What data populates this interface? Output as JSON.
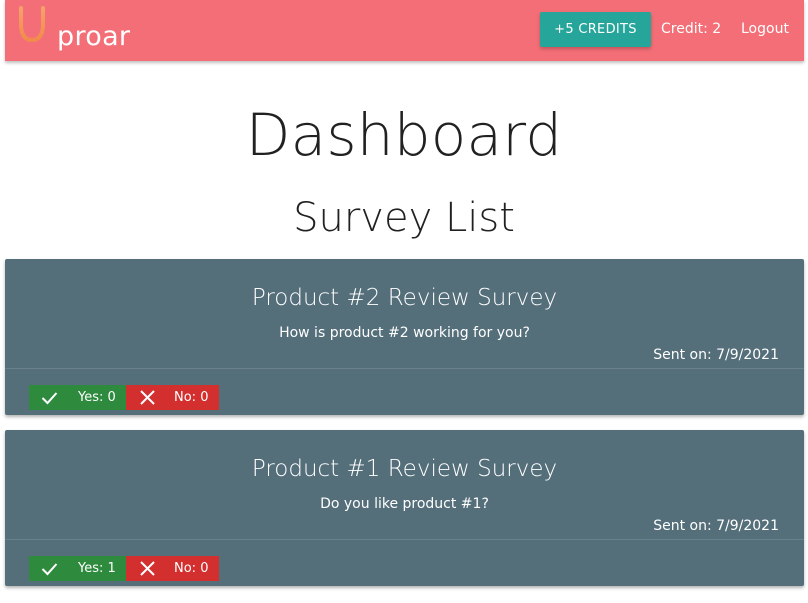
{
  "colors": {
    "navbar": "#f36e76",
    "credits_button": "#26a69a",
    "card": "#546e7a",
    "yes": "#2e8b3e",
    "no": "#d32f2f"
  },
  "navbar": {
    "brand_icon": "horseshoe-logo-icon",
    "brand_name": "proar",
    "credits_button_label": "+5 CREDITS",
    "credit_label": "Credit: 2",
    "logout_label": "Logout"
  },
  "page": {
    "title": "Dashboard",
    "section_title": "Survey List"
  },
  "surveys": [
    {
      "title": "Product #2 Review Survey",
      "body": "How is product #2 working for you?",
      "sent_on": "Sent on: 7/9/2021",
      "yes_label": "Yes: 0",
      "no_label": "No: 0",
      "yes_icon": "check-icon",
      "no_icon": "close-icon"
    },
    {
      "title": "Product #1 Review Survey",
      "body": "Do you like product #1?",
      "sent_on": "Sent on: 7/9/2021",
      "yes_label": "Yes: 1",
      "no_label": "No: 0",
      "yes_icon": "check-icon",
      "no_icon": "close-icon"
    }
  ]
}
